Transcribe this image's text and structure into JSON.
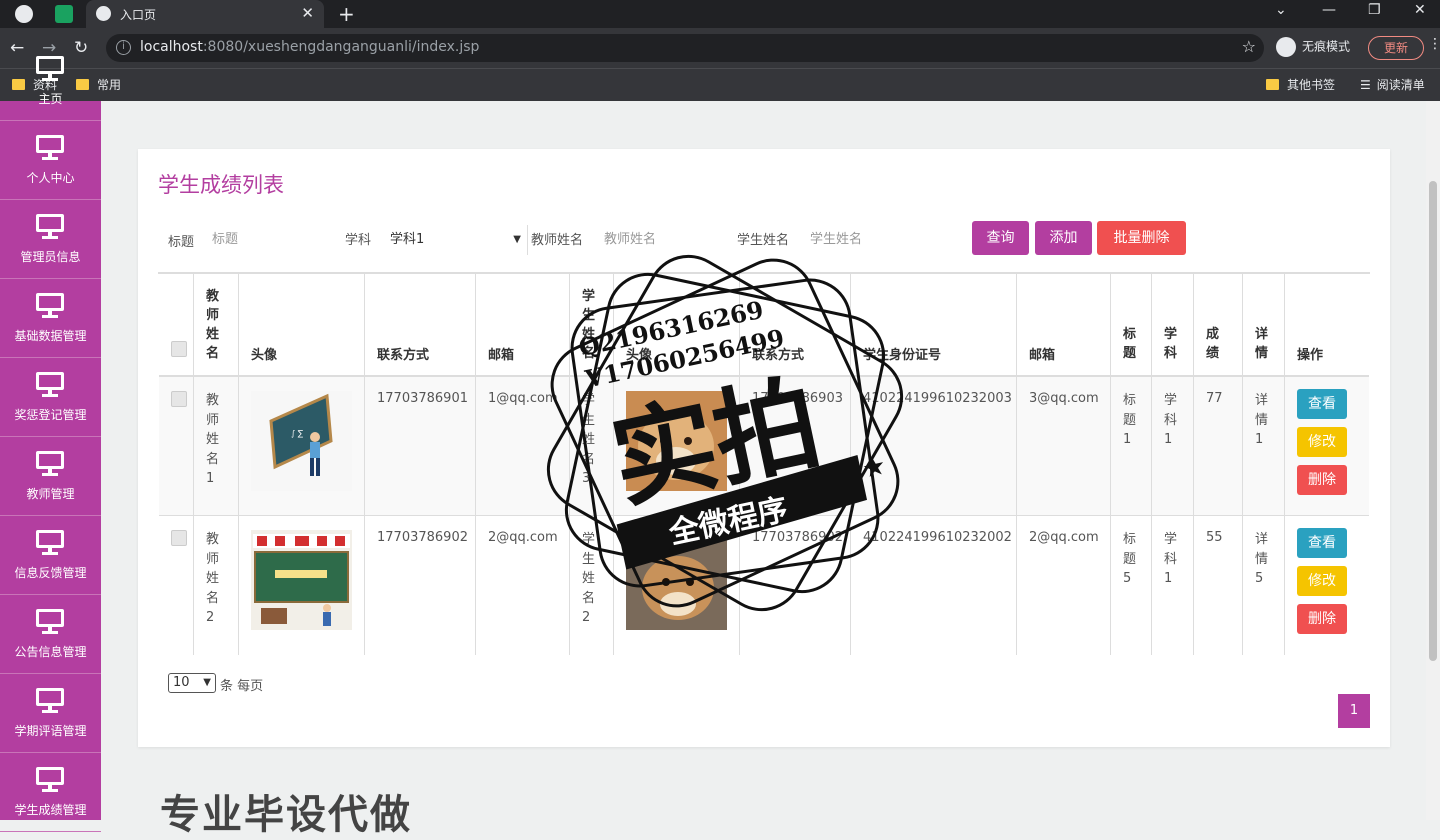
{
  "browser": {
    "tab_title": "入口页",
    "url_host": "localhost",
    "url_rest": ":8080/xueshengdanganguanli/index.jsp",
    "incognito_label": "无痕模式",
    "update_label": "更新",
    "bookmarks": [
      "资料",
      "常用"
    ],
    "bookmarks_right": [
      "其他书签",
      "阅读清单"
    ]
  },
  "sidebar": {
    "items": [
      {
        "label": "主页",
        "icon": "monitor-icon"
      },
      {
        "label": "个人中心",
        "icon": "monitor-icon"
      },
      {
        "label": "管理员信息",
        "icon": "monitor-icon"
      },
      {
        "label": "基础数据管理",
        "icon": "monitor-icon"
      },
      {
        "label": "奖惩登记管理",
        "icon": "monitor-icon"
      },
      {
        "label": "教师管理",
        "icon": "monitor-icon"
      },
      {
        "label": "信息反馈管理",
        "icon": "monitor-icon"
      },
      {
        "label": "公告信息管理",
        "icon": "monitor-icon"
      },
      {
        "label": "学期评语管理",
        "icon": "monitor-icon"
      },
      {
        "label": "学生成绩管理",
        "icon": "monitor-icon"
      }
    ]
  },
  "page": {
    "title": "学生成绩列表",
    "filters": {
      "title_label": "标题",
      "title_placeholder": "标题",
      "subject_label": "学科",
      "subject_value": "学科1",
      "teacher_label": "教师姓名",
      "teacher_placeholder": "教师姓名",
      "student_label": "学生姓名",
      "student_placeholder": "学生姓名"
    },
    "buttons": {
      "query": "查询",
      "add": "添加",
      "batch_delete": "批量删除"
    },
    "table": {
      "headers": [
        "教师姓名",
        "头像",
        "联系方式",
        "邮箱",
        "学生姓名",
        "头像",
        "联系方式",
        "学生身份证号",
        "邮箱",
        "标题",
        "学科",
        "成绩",
        "详情",
        "操作"
      ],
      "rows": [
        {
          "teacher_name": "教师姓名1",
          "teacher_phone": "17703786901",
          "teacher_email": "1@qq.com",
          "student_name": "学生姓名3",
          "student_phone": "17703786903",
          "student_id": "410224199610232003",
          "student_email": "3@qq.com",
          "title": "标题1",
          "subject": "学科1",
          "score": "77",
          "detail": "详情1"
        },
        {
          "teacher_name": "教师姓名2",
          "teacher_phone": "17703786902",
          "teacher_email": "2@qq.com",
          "student_name": "学生姓名2",
          "student_phone": "17703786902",
          "student_id": "410224199610232002",
          "student_email": "2@qq.com",
          "title": "标题5",
          "subject": "学科1",
          "score": "55",
          "detail": "详情5"
        }
      ],
      "actions": {
        "view": "查看",
        "edit": "修改",
        "delete": "删除"
      }
    },
    "pagination": {
      "page_size": "10",
      "page_size_label": "条 每页",
      "current_page": "1"
    }
  },
  "watermark": {
    "line1": "Q2196316269",
    "line2": "V17060256499",
    "big": "实拍",
    "banner": "全微程序"
  },
  "footer_text": "专业毕设代做",
  "colors": {
    "accent": "#b33ea0",
    "info": "#2aa1c0",
    "warning": "#f5c400",
    "danger": "#f05050"
  }
}
